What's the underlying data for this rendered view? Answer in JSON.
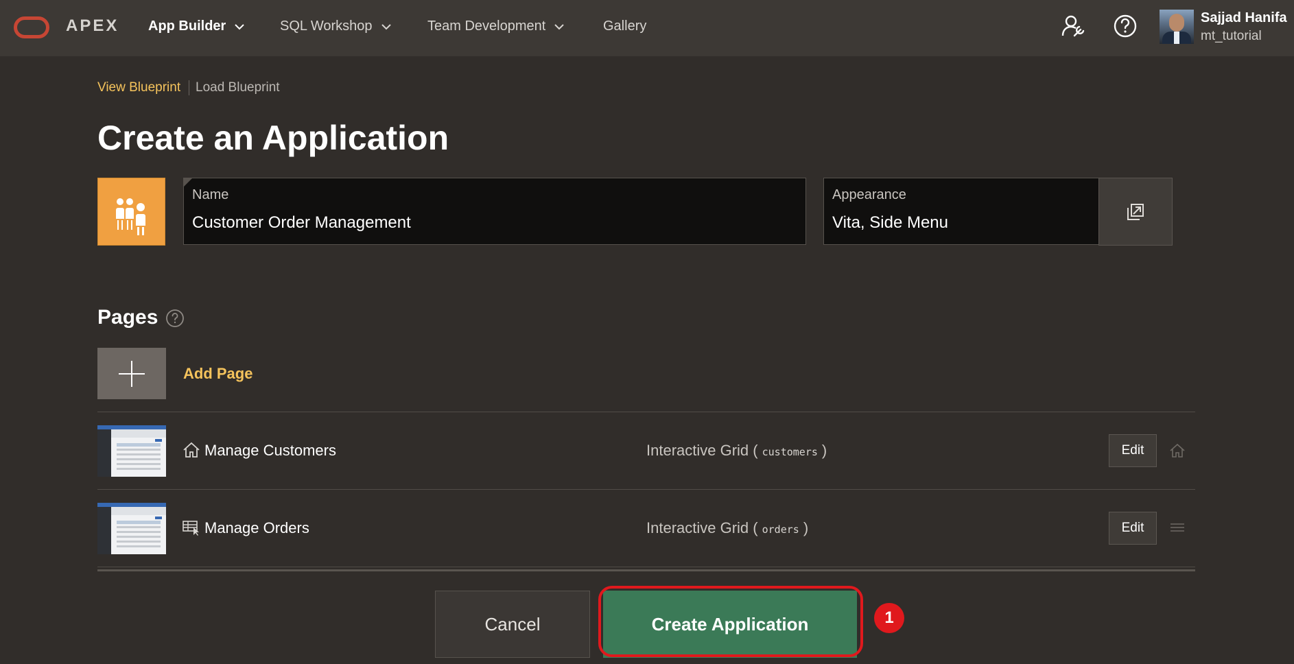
{
  "header": {
    "logo_text": "APEX",
    "nav": [
      {
        "label": "App Builder",
        "active": true,
        "has_menu": true
      },
      {
        "label": "SQL Workshop",
        "active": false,
        "has_menu": true
      },
      {
        "label": "Team Development",
        "active": false,
        "has_menu": true
      },
      {
        "label": "Gallery",
        "active": false,
        "has_menu": false
      }
    ],
    "icons": [
      "administration-icon",
      "help-icon"
    ],
    "user": {
      "name": "Sajjad Hanifa",
      "workspace": "mt_tutorial"
    }
  },
  "breadcrumb": {
    "view_blueprint": "View Blueprint",
    "load_blueprint": "Load Blueprint"
  },
  "page_title": "Create an Application",
  "form": {
    "name_label": "Name",
    "name_value": "Customer Order Management",
    "appearance_label": "Appearance",
    "appearance_value": "Vita, Side Menu"
  },
  "pages": {
    "title": "Pages",
    "add_label": "Add Page",
    "items": [
      {
        "name": "Manage Customers",
        "type": "Interactive Grid",
        "table": "customers",
        "edit_label": "Edit",
        "icon": "home-icon",
        "end_icon": "home-icon"
      },
      {
        "name": "Manage Orders",
        "type": "Interactive Grid",
        "table": "orders",
        "edit_label": "Edit",
        "icon": "interactive-grid-icon",
        "end_icon": "drag-handle-icon"
      }
    ]
  },
  "footer": {
    "cancel_label": "Cancel",
    "create_label": "Create Application",
    "step_badge": "1"
  },
  "colors": {
    "background": "#312d2a",
    "topbar": "#3d3935",
    "accent_link": "#f5c35c",
    "create_button": "#3b7a57",
    "highlight": "#e0191d",
    "app_icon": "#f0a041"
  }
}
